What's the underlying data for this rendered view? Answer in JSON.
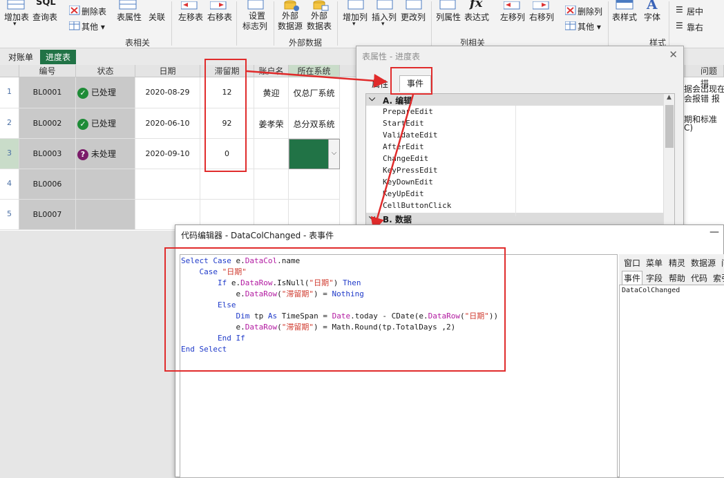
{
  "ribbon": {
    "buttons": {
      "add_table": "增加表",
      "query_table": "查询表",
      "delete_table": "删除表",
      "other": "其他",
      "table_props": "表属性",
      "relation": "关联",
      "move_left": "左移表",
      "move_right": "右移表",
      "settings_flag": "设置",
      "settings_flag2": "标志列",
      "ext_source": "外部",
      "ext_source2": "数据源",
      "ext_table": "外部",
      "ext_table2": "数据表",
      "add_col": "增加列",
      "insert_col": "插入列",
      "change_col": "更改列",
      "col_props": "列属性",
      "expression": "表达式",
      "col_left": "左移列",
      "col_right": "右移列",
      "delete_col": "删除列",
      "other2": "其他",
      "table_style": "表样式",
      "font": "字体",
      "center": "居中",
      "align_right": "靠右",
      "sql_icon": "SQL",
      "fx_icon": "fx",
      "font_icon": "A"
    },
    "groups": {
      "table": "表相关",
      "external": "外部数据",
      "column": "列相关",
      "style": "样式"
    }
  },
  "tabs": [
    "对账单",
    "进度表"
  ],
  "grid": {
    "headers": [
      "编号",
      "状态",
      "日期",
      "滞留期",
      "账户名",
      "所在系统",
      "问题描"
    ],
    "rows": [
      {
        "n": "1",
        "id": "BL0001",
        "status": "已处理",
        "date": "2020-08-29",
        "days": "12",
        "account": "黄迎",
        "system": "仅总厂系统"
      },
      {
        "n": "2",
        "id": "BL0002",
        "status": "已处理",
        "date": "2020-06-10",
        "days": "92",
        "account": "姜孝荣",
        "system": "总分双系统"
      },
      {
        "n": "3",
        "id": "BL0003",
        "status": "未处理",
        "date": "2020-09-10",
        "days": "0",
        "account": "",
        "system": ""
      },
      {
        "n": "4",
        "id": "BL0006",
        "status": "",
        "date": "",
        "days": "",
        "account": "",
        "system": ""
      },
      {
        "n": "5",
        "id": "BL0007",
        "status": "",
        "date": "",
        "days": "",
        "account": "",
        "system": ""
      }
    ],
    "right_text": [
      "据会出现在",
      "会报错  报",
      "期和标准",
      "C)"
    ]
  },
  "dialog1": {
    "title": "表属性 - 进度表",
    "tabs": [
      "属性",
      "事件"
    ],
    "cat_a": "A. 编辑",
    "events": [
      "PrepareEdit",
      "StartEdit",
      "ValidateEdit",
      "AfterEdit",
      "ChangeEdit",
      "KeyPressEdit",
      "KeyDownEdit",
      "KeyUpEdit",
      "CellButtonClick"
    ],
    "cat_b": "B. 数据"
  },
  "dialog2": {
    "title": "代码编辑器 - DataColChanged - 表事件",
    "menu1": [
      "窗口",
      "菜单",
      "精灵",
      "数据源",
      "问"
    ],
    "menu2": [
      "事件",
      "字段",
      "帮助",
      "代码",
      "索引"
    ],
    "event_name": "DataColChanged",
    "code": {
      "l1a": "Select Case",
      "l1b": " e.",
      "l1c": "DataCol",
      ".name": "",
      "l1d": ".name",
      "l2a": "    Case ",
      "l2b": "\"日期\"",
      "l3a": "        If ",
      "l3b": "e.",
      "l3c": "DataRow",
      ".IsNull(": "",
      "l3d": ".IsNull(",
      "l3e": "\"日期\"",
      "l3f": ") ",
      "l3g": "Then",
      "l4a": "            e.",
      "l4b": "DataRow",
      "l4c": "(",
      "l4d": "\"滞留期\"",
      "l4e": ") = ",
      "l4f": "Nothing",
      "l5": "        Else",
      "l6a": "            Dim",
      "l6b": " tp ",
      "l6c": "As",
      "l6d": " TimeSpan = ",
      "l6e": "Date",
      ".today - CDate(e.": "",
      "l6f": ".today - CDate(e.",
      "l6g": "DataRow",
      "l6h": "(",
      "l6i": "\"日期\"",
      "l6j": "))",
      "l7a": "            e.",
      "l7b": "DataRow",
      "l7c": "(",
      "l7d": "\"滞留期\"",
      "l7e": ") = Math.Round(tp.TotalDays ,2)",
      "l8": "        End If",
      "l9": "End Select"
    }
  }
}
